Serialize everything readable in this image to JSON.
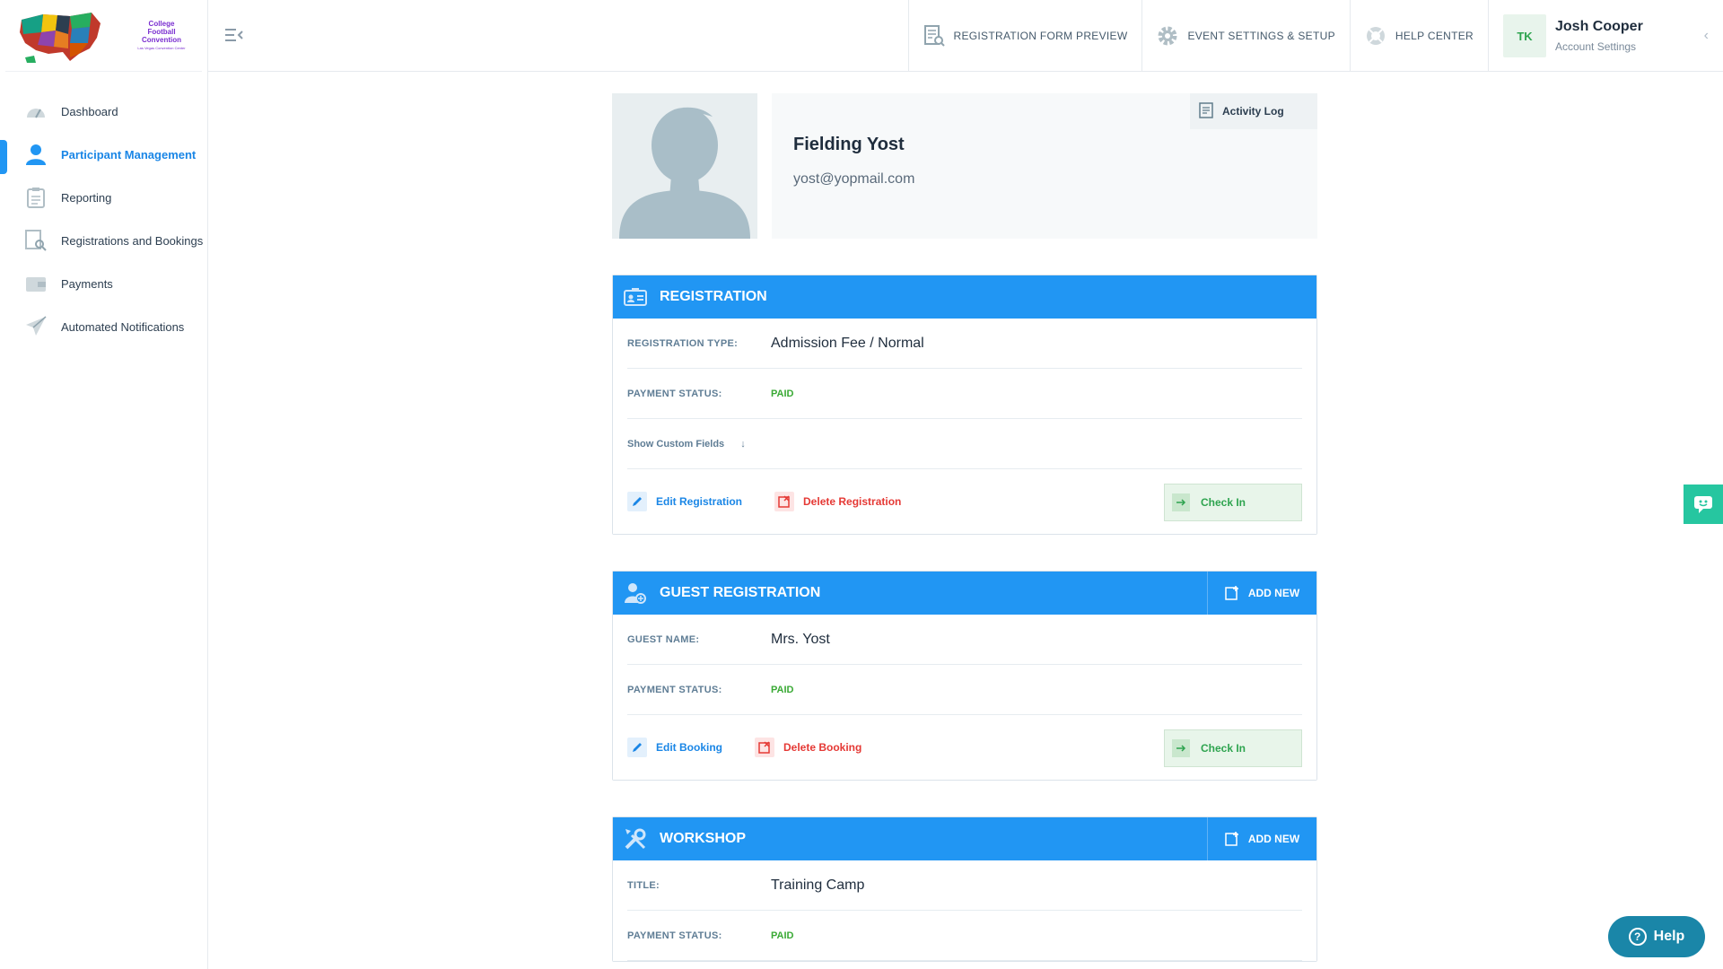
{
  "app": {
    "logo_text": "College Football Convention",
    "logo_subtext": "Las Vegas Convention Center"
  },
  "sidebar": {
    "items": [
      {
        "label": "Dashboard",
        "icon": "dashboard-gauge-icon"
      },
      {
        "label": "Participant Management",
        "icon": "user-icon",
        "active": true
      },
      {
        "label": "Reporting",
        "icon": "clipboard-icon"
      },
      {
        "label": "Registrations and Bookings",
        "icon": "registration-search-icon"
      },
      {
        "label": "Payments",
        "icon": "wallet-icon"
      },
      {
        "label": "Automated Notifications",
        "icon": "paper-plane-icon"
      }
    ]
  },
  "topbar": {
    "registration_form_preview": "REGISTRATION FORM PREVIEW",
    "event_settings": "EVENT SETTINGS & SETUP",
    "help_center": "HELP CENTER",
    "user": {
      "initials": "TK",
      "name": "Josh Cooper",
      "sub": "Account Settings"
    }
  },
  "profile": {
    "name": "Fielding Yost",
    "email": "yost@yopmail.com",
    "activity_log": "Activity Log"
  },
  "registration": {
    "title": "REGISTRATION",
    "type_label": "REGISTRATION TYPE:",
    "type_value": "Admission Fee / Normal",
    "payment_label": "PAYMENT STATUS:",
    "payment_value": "PAID",
    "custom_fields": "Show Custom Fields",
    "edit": "Edit Registration",
    "delete": "Delete Registration",
    "checkin": "Check In"
  },
  "guest": {
    "title": "GUEST REGISTRATION",
    "add_new": "ADD NEW",
    "name_label": "GUEST NAME:",
    "name_value": "Mrs. Yost",
    "payment_label": "PAYMENT STATUS:",
    "payment_value": "PAID",
    "edit": "Edit Booking",
    "delete": "Delete Booking",
    "checkin": "Check In"
  },
  "workshop": {
    "title": "WORKSHOP",
    "add_new": "ADD NEW",
    "title_label": "TITLE:",
    "title_value": "Training Camp",
    "payment_label": "PAYMENT STATUS:",
    "payment_value": "PAID"
  },
  "help_button": "Help",
  "colors": {
    "primary": "#2196f3",
    "paid": "#3aaa35",
    "danger": "#e53935",
    "checkin_bg": "#e8f5ea"
  }
}
